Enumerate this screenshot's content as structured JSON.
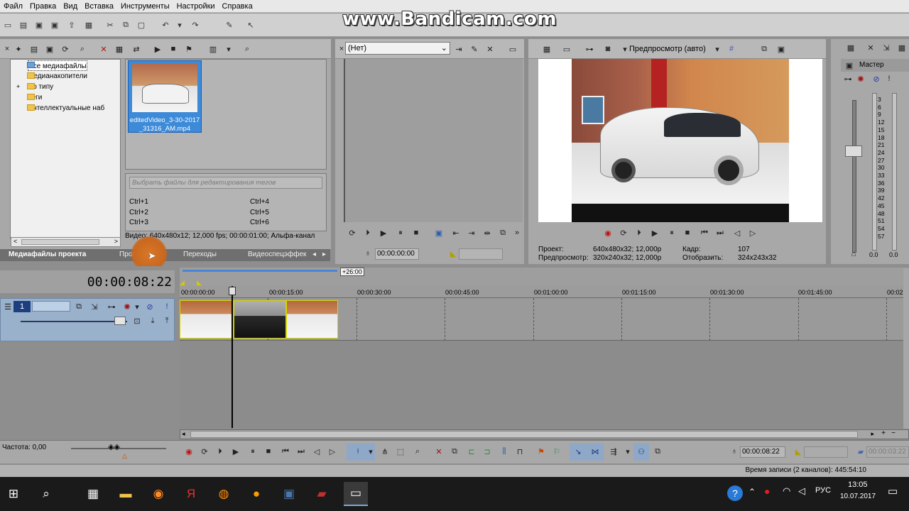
{
  "menu": [
    "Файл",
    "Правка",
    "Вид",
    "Вставка",
    "Инструменты",
    "Настройки",
    "Справка"
  ],
  "watermark": "www.Bandicam.com",
  "explorer": {
    "tree": [
      "Все медиафайлы",
      "Медианакопители",
      "По типу",
      "Теги",
      "Интеллектуальные наб"
    ],
    "expand_marker": "+",
    "file_name": "editedVideo_3-30-2017_31316_AM.mp4",
    "tag_placeholder": "Выбрать файлы для редактирования тегов",
    "shortcuts": [
      "Ctrl+1",
      "Ctrl+2",
      "Ctrl+3",
      "Ctrl+4",
      "Ctrl+5",
      "Ctrl+6"
    ],
    "info": "Видео: 640x480x12; 12,000 fps; 00:00:01:00; Альфа-канал"
  },
  "tabs": [
    "Медиафайлы проекта",
    "Проводник",
    "Переходы",
    "Видеоспецэффек"
  ],
  "trimmer": {
    "select_value": "(Нет)",
    "timecode": "00:00:00:00"
  },
  "preview": {
    "mode": "Предпросмотр (авто)",
    "project_label": "Проект:",
    "project_value": "640x480x32; 12,000p",
    "preview_label": "Предпросмотр:",
    "preview_value": "320x240x32; 12,000p",
    "frame_label": "Кадр:",
    "frame_value": "107",
    "display_label": "Отобразить:",
    "display_value": "324x243x32"
  },
  "mixer": {
    "title": "Мастер",
    "scale": [
      "3",
      "6",
      "9",
      "12",
      "15",
      "18",
      "21",
      "24",
      "27",
      "30",
      "33",
      "36",
      "39",
      "42",
      "45",
      "48",
      "51",
      "54",
      "57"
    ],
    "left_value": "0.0",
    "right_value": "0.0"
  },
  "timeline": {
    "current_time": "00:00:08:22",
    "region_label": "+26:00",
    "ruler": [
      "00:00:00:00",
      "00:00:15:00",
      "00:00:30:00",
      "00:00:45:00",
      "00:01:00:00",
      "00:01:15:00",
      "00:01:30:00",
      "00:01:45:00",
      "00:02"
    ],
    "track_number": "1",
    "rate_label": "Частота: 0,00",
    "cursor_time": "00:00:08:22",
    "end_time": "00:00:03:22"
  },
  "status": {
    "record_time": "Время записи (2 каналов): 445:54:10"
  },
  "taskbar": {
    "language": "РУС",
    "time": "13:05",
    "date": "10.07.2017"
  }
}
